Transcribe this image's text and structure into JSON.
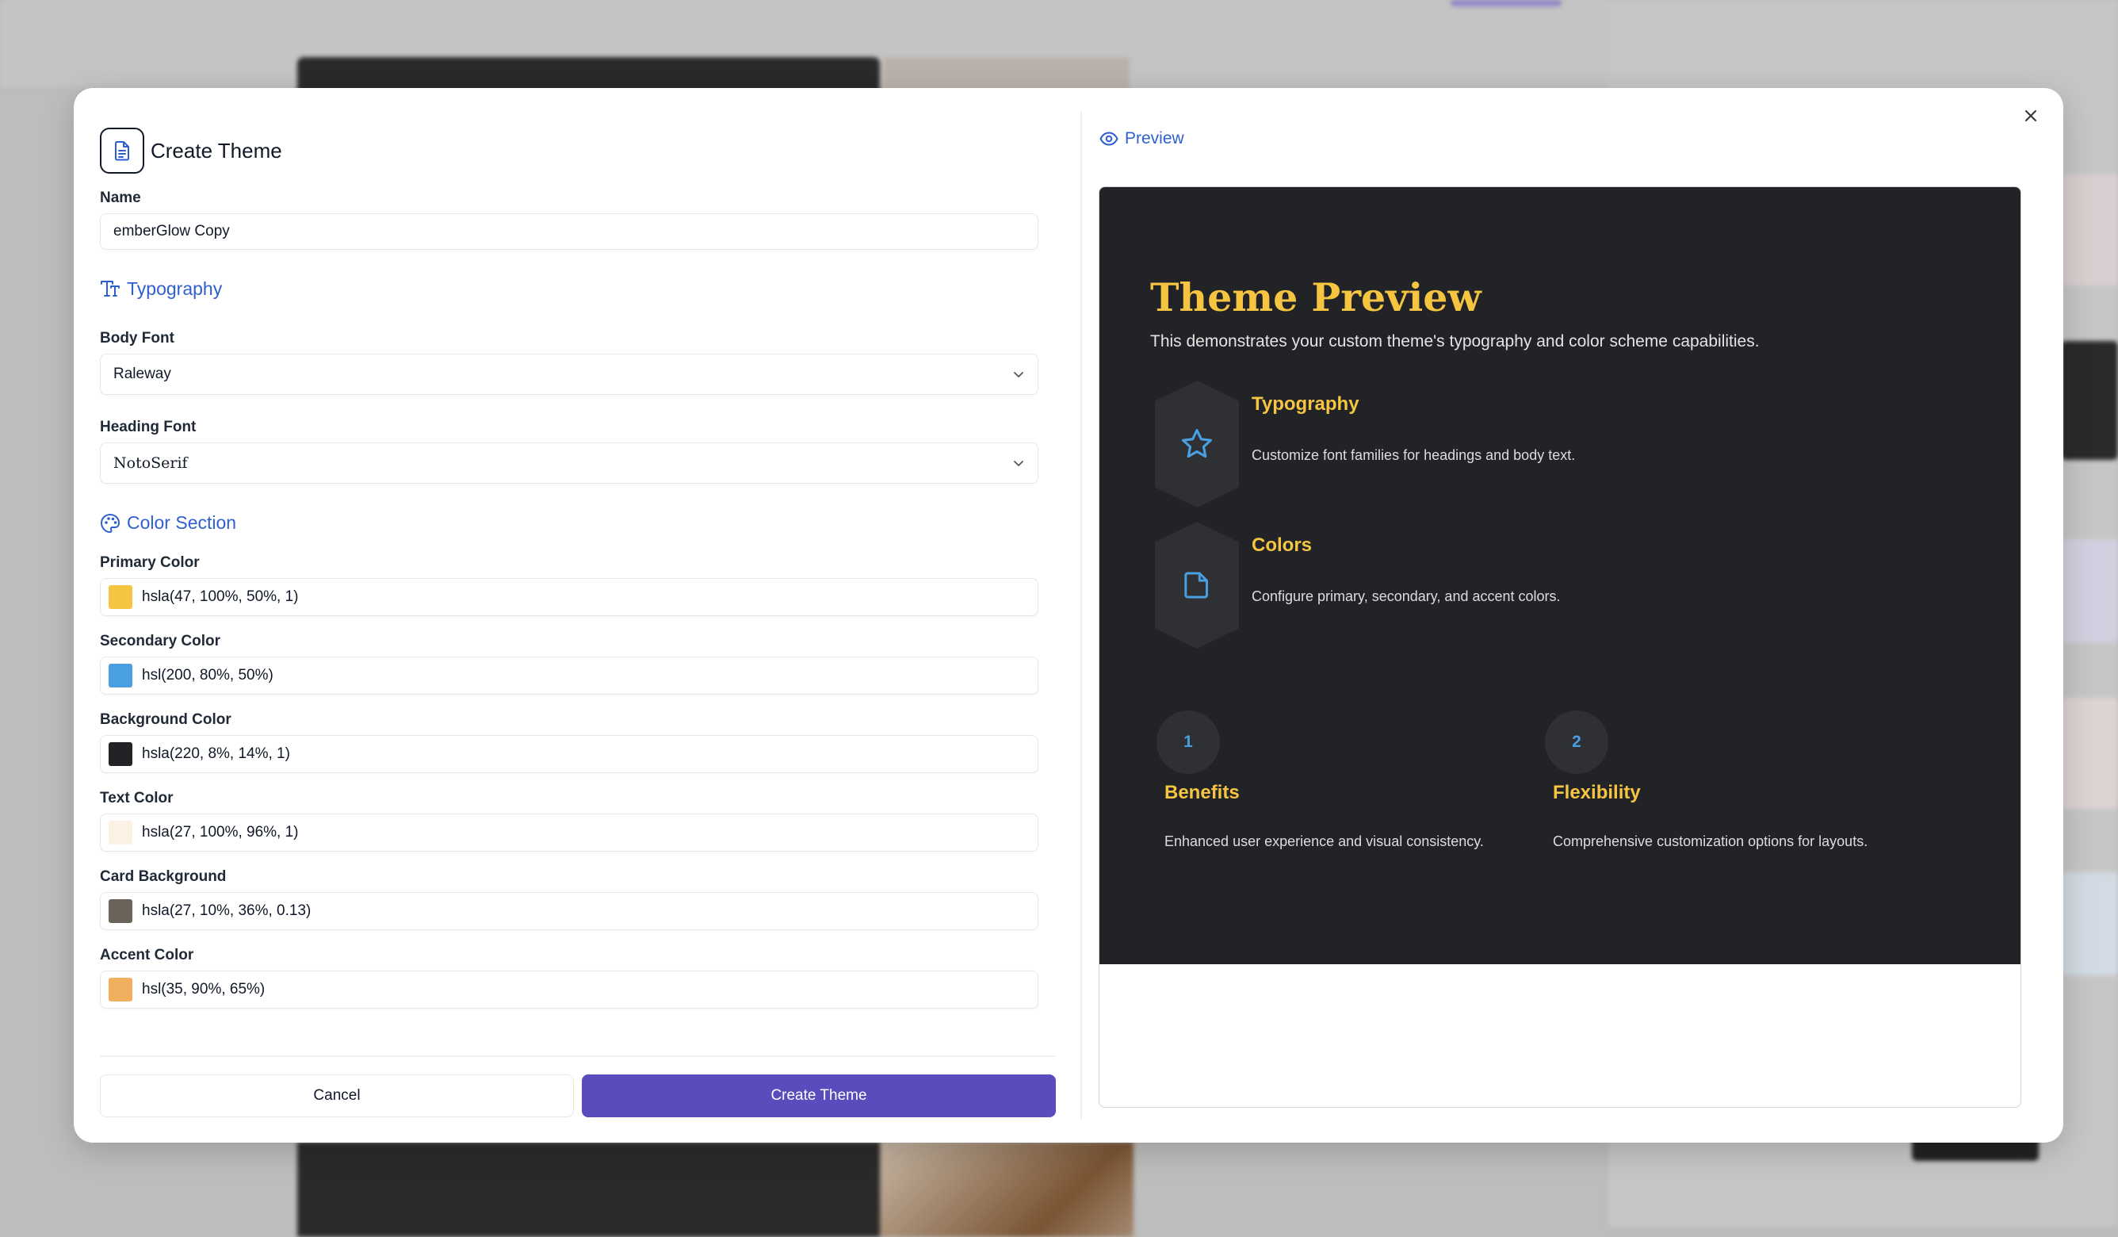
{
  "dialog": {
    "title": "Create Theme",
    "name_label": "Name",
    "name_value": "emberGlow Copy",
    "typography": {
      "heading": "Typography",
      "body_font_label": "Body Font",
      "body_font_value": "Raleway",
      "heading_font_label": "Heading Font",
      "heading_font_value": "NotoSerif"
    },
    "colors": {
      "heading": "Color Section",
      "fields": [
        {
          "label": "Primary Color",
          "value": "hsla(47, 100%, 50%, 1)",
          "swatch": "#f5c542"
        },
        {
          "label": "Secondary Color",
          "value": "hsl(200, 80%, 50%)",
          "swatch": "#4a9fe0"
        },
        {
          "label": "Background Color",
          "value": "hsla(220, 8%, 14%, 1)",
          "swatch": "#222326"
        },
        {
          "label": "Text Color",
          "value": "hsla(27, 100%, 96%, 1)",
          "swatch": "#fdf1e6"
        },
        {
          "label": "Card Background",
          "value": "hsla(27, 10%, 36%, 0.13)",
          "swatch": "#6b625a"
        },
        {
          "label": "Accent Color",
          "value": "hsl(35, 90%, 65%)",
          "swatch": "#f0b060"
        }
      ]
    },
    "buttons": {
      "cancel": "Cancel",
      "create": "Create Theme"
    }
  },
  "preview": {
    "label": "Preview",
    "heading": "Theme Preview",
    "subtitle": "This demonstrates your custom theme's typography and color scheme capabilities.",
    "features": [
      {
        "title": "Typography",
        "desc": "Customize font families for headings and body text.",
        "icon": "star-icon"
      },
      {
        "title": "Colors",
        "desc": "Configure primary, secondary, and accent colors.",
        "icon": "file-icon"
      }
    ],
    "numbered": [
      {
        "number": "1",
        "title": "Benefits",
        "desc": "Enhanced user experience and visual consistency."
      },
      {
        "number": "2",
        "title": "Flexibility",
        "desc": "Comprehensive customization options for layouts."
      }
    ]
  },
  "accent_colors": {
    "brand_purple": "#5b4cbd",
    "link_blue": "#2f5fce",
    "preview_primary": "#f5c542",
    "preview_secondary": "#4a9fe0",
    "preview_background": "#222326"
  }
}
